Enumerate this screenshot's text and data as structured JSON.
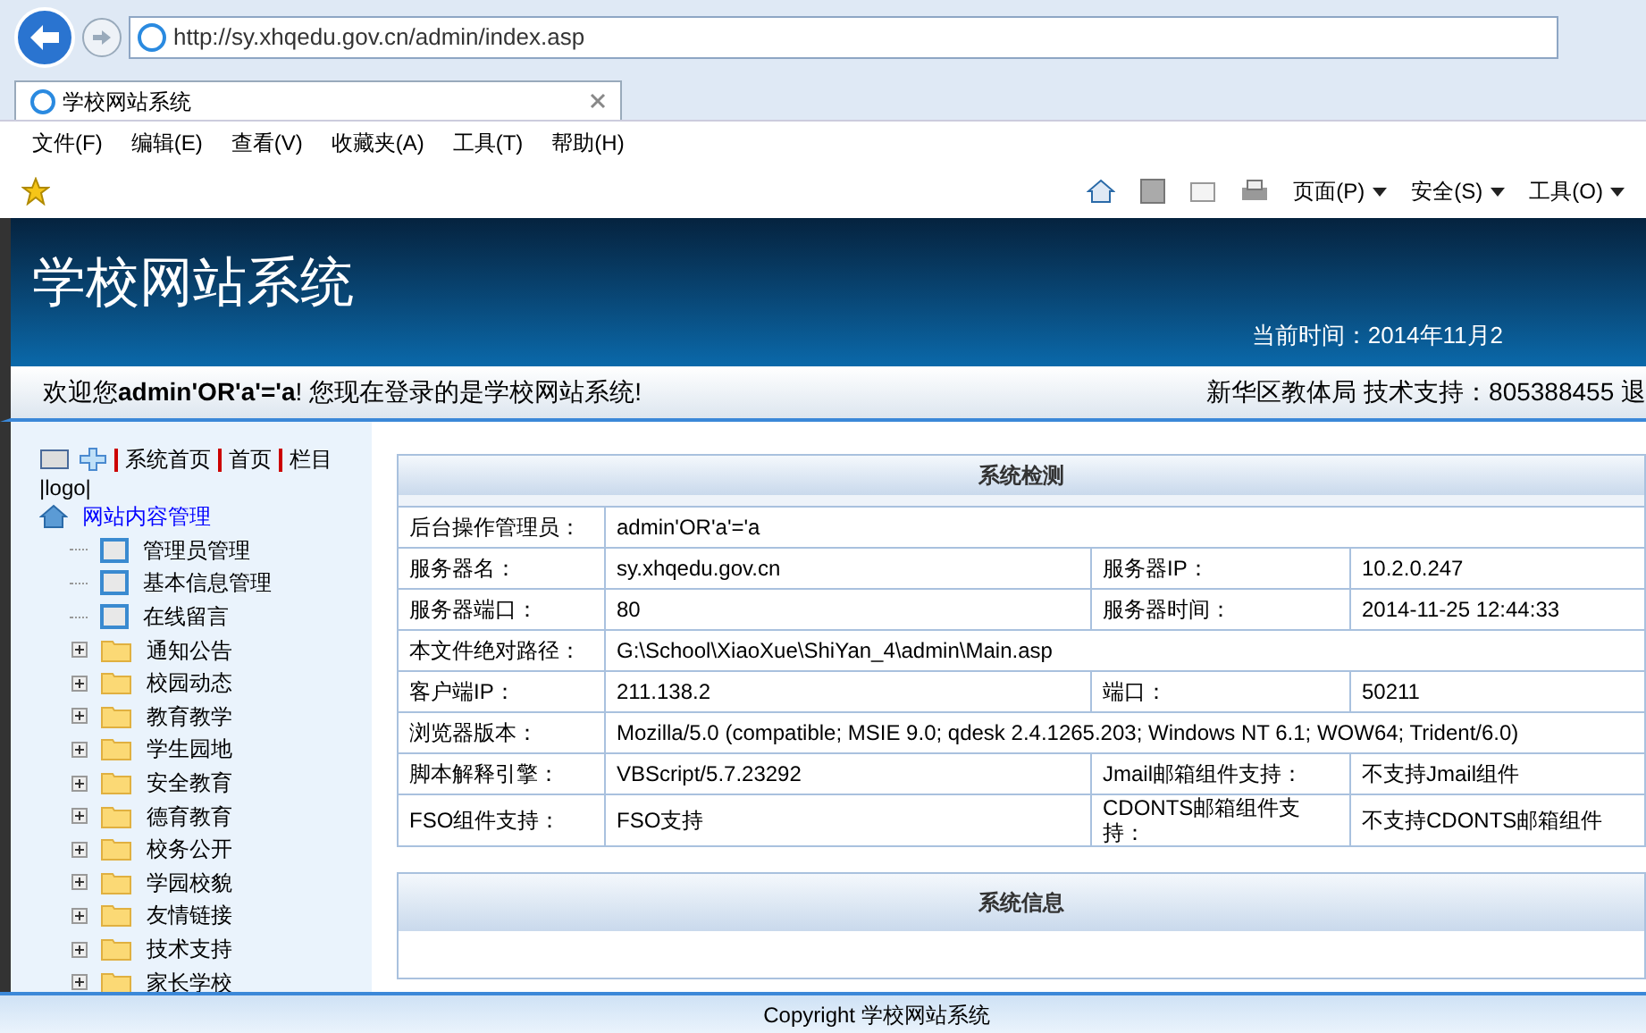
{
  "browser": {
    "url": "http://sy.xhqedu.gov.cn/admin/index.asp",
    "tab": {
      "title": "学校网站系统",
      "selected": true
    },
    "menu": [
      "文件(F)",
      "编辑(E)",
      "查看(V)",
      "收藏夹(A)",
      "工具(T)",
      "帮助(H)"
    ],
    "toolbar": [
      "页面(P)",
      "安全(S)",
      "工具(O)"
    ]
  },
  "header": {
    "title": "学校网站系统",
    "time": "当前时间：2014年11月2"
  },
  "welcome": {
    "text": "欢迎您**admin'OR'a'='a**! 您现在登录的是学校网站系统!",
    "right": "新华区教体局 技术支持：805388455 退"
  },
  "sidebar": {
    "links": [
      "系统首页",
      "首页",
      "栏目"
    ],
    "logo": "|logo|",
    "tree": [
      {
        "label": "网站内容管理",
        "kind": "root",
        "expanded": true,
        "children": [
          {
            "label": "管理员管理",
            "kind": "page"
          },
          {
            "label": "基本信息管理",
            "kind": "page"
          },
          {
            "label": "在线留言",
            "kind": "page"
          },
          {
            "label": "通知公告",
            "kind": "folder",
            "expanded": false
          },
          {
            "label": "校园动态",
            "kind": "folder",
            "expanded": false
          },
          {
            "label": "教育教学",
            "kind": "folder",
            "expanded": false
          },
          {
            "label": "学生园地",
            "kind": "folder",
            "expanded": false
          },
          {
            "label": "安全教育",
            "kind": "folder",
            "expanded": false
          },
          {
            "label": "德育教育",
            "kind": "folder",
            "expanded": false
          },
          {
            "label": "校务公开",
            "kind": "folder",
            "expanded": false
          },
          {
            "label": "学园校貌",
            "kind": "folder",
            "expanded": false
          },
          {
            "label": "友情链接",
            "kind": "folder",
            "expanded": false
          },
          {
            "label": "技术支持",
            "kind": "folder",
            "expanded": false
          },
          {
            "label": "家长学校",
            "kind": "folder",
            "expanded": false
          }
        ]
      }
    ]
  },
  "system_check": {
    "title": "系统检测",
    "rows": [
      [
        "后台操作管理员：",
        "admin'OR'a'='a"
      ],
      [
        "服务器名：",
        "sy.xhqedu.gov.cn",
        "服务器IP：",
        "10.2.0.247"
      ],
      [
        "服务器端口：",
        "80",
        "服务器时间：",
        "2014-11-25 12:44:33"
      ],
      [
        "本文件绝对路径：",
        "G:\\School\\XiaoXue\\ShiYan_4\\admin\\Main.asp"
      ],
      [
        "客户端IP：",
        "211.138.2",
        "端口：",
        "50211"
      ],
      [
        "浏览器版本：",
        "Mozilla/5.0 (compatible; MSIE 9.0; qdesk 2.4.1265.203; Windows NT 6.1; WOW64; Trident/6.0)"
      ],
      [
        "脚本解释引擎：",
        "VBScript/5.7.23292",
        "Jmail邮箱组件支持：",
        "不支持Jmail组件"
      ],
      [
        "FSO组件支持：",
        "FSO支持",
        "CDONTS邮箱组件支持：",
        "不支持CDONTS邮箱组件"
      ]
    ]
  },
  "system_info": {
    "title": "系统信息"
  },
  "footer": "Copyright 学校网站系统"
}
